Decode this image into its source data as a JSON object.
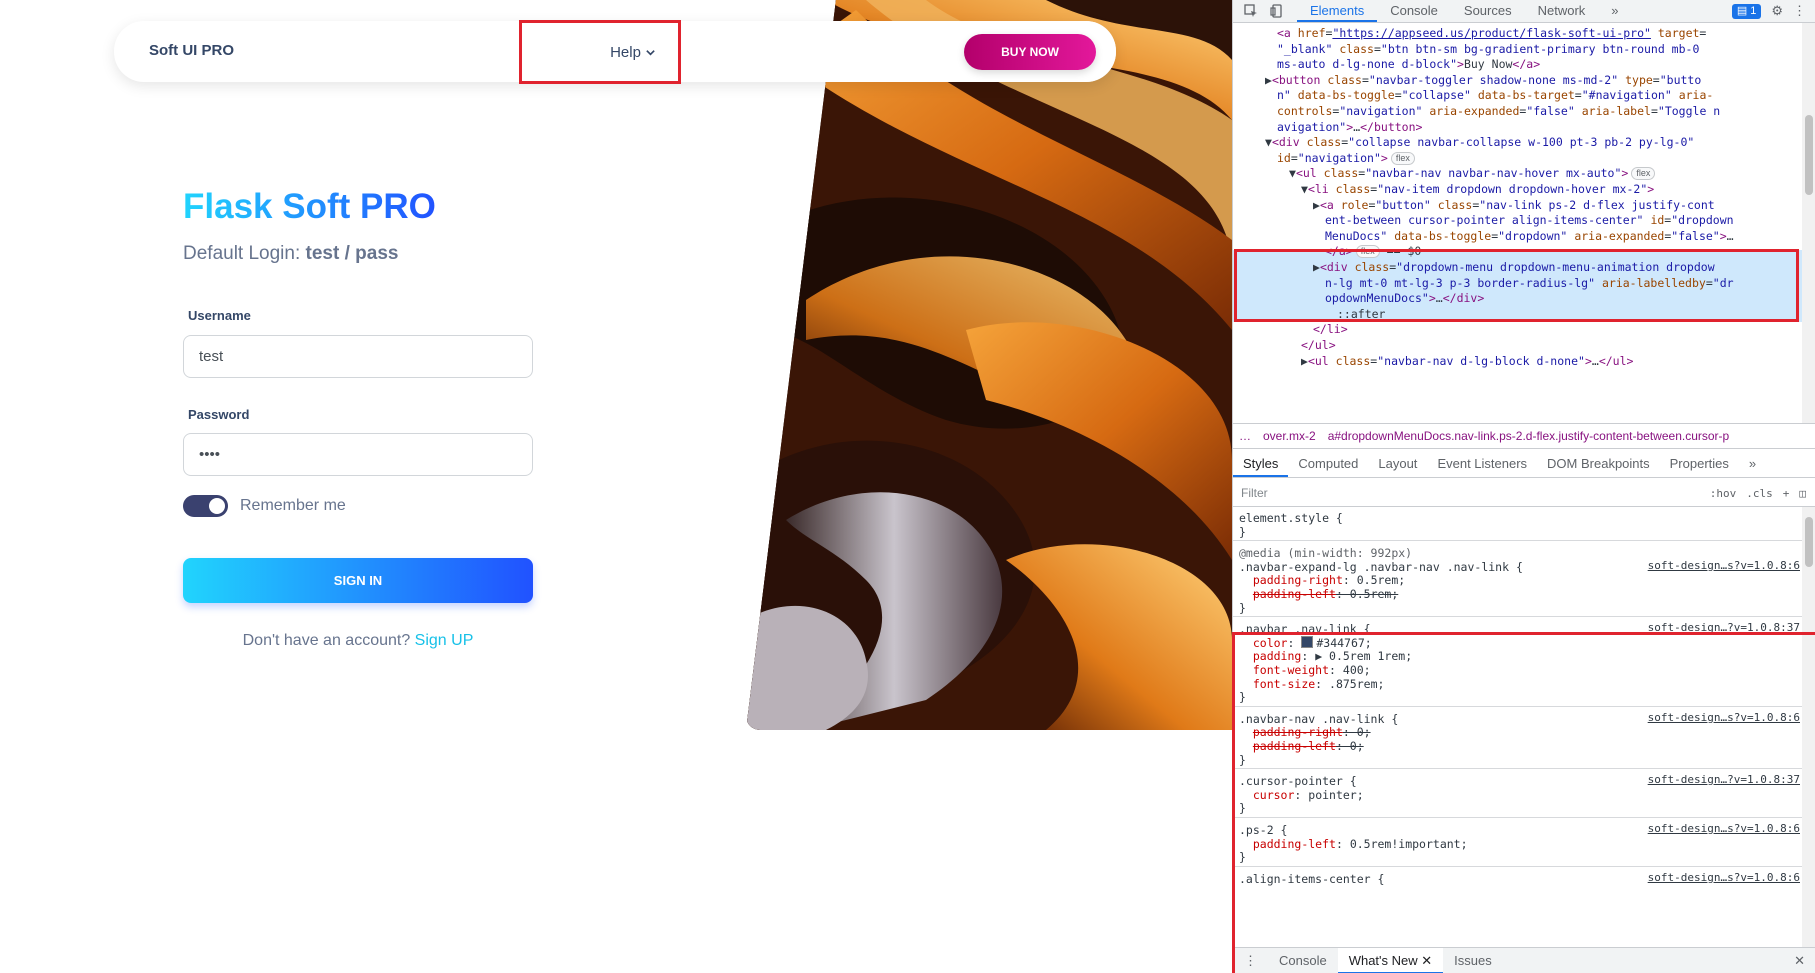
{
  "page": {
    "navbar": {
      "brand": "Soft UI PRO",
      "help_label": "Help",
      "buy_label": "BUY NOW"
    },
    "login": {
      "title": "Flask Soft PRO",
      "subtitle_prefix": "Default Login: ",
      "subtitle_credentials": "test / pass",
      "username_label": "Username",
      "username_value": "test",
      "password_label": "Password",
      "password_value": "••••",
      "remember_label": "Remember me",
      "remember_checked": true,
      "signin_label": "SIGN IN",
      "signup_prompt": "Don't have an account? ",
      "signup_link": "Sign UP"
    }
  },
  "devtools": {
    "tabs": [
      "Elements",
      "Console",
      "Sources",
      "Network"
    ],
    "more_tabs": "»",
    "issues_count": "1",
    "elements_lines": [
      {
        "indent": 3,
        "html": "<span class=\"tag\">&lt;a</span> <span class=\"attr\">href</span>=<span class=\"url\">\"https://appseed.us/product/flask-soft-ui-pro\"</span> <span class=\"attr\">target</span>="
      },
      {
        "indent": 3,
        "html": "<span class=\"val\">\"_blank\"</span> <span class=\"attr\">class</span>=<span class=\"val\">\"btn btn-sm  bg-gradient-primary  btn-round mb-0</span>"
      },
      {
        "indent": 3,
        "html": "<span class=\"val\">ms-auto d-lg-none d-block\"</span><span class=\"tag\">&gt;</span><span class=\"txt\">Buy Now</span><span class=\"tag\">&lt;/a&gt;</span>"
      },
      {
        "indent": 2,
        "html": "<span class=\"txt\">▶</span><span class=\"tag\">&lt;button</span> <span class=\"attr\">class</span>=<span class=\"val\">\"navbar-toggler shadow-none ms-md-2\"</span> <span class=\"attr\">type</span>=<span class=\"val\">\"butto</span>"
      },
      {
        "indent": 3,
        "html": "<span class=\"val\">n\"</span> <span class=\"attr\">data-bs-toggle</span>=<span class=\"val\">\"collapse\"</span> <span class=\"attr\">data-bs-target</span>=<span class=\"val\">\"#navigation\"</span> <span class=\"attr\">aria-</span>"
      },
      {
        "indent": 3,
        "html": "<span class=\"attr\">controls</span>=<span class=\"val\">\"navigation\"</span> <span class=\"attr\">aria-expanded</span>=<span class=\"val\">\"false\"</span> <span class=\"attr\">aria-label</span>=<span class=\"val\">\"Toggle n</span>"
      },
      {
        "indent": 3,
        "html": "<span class=\"val\">avigation\"</span><span class=\"tag\">&gt;</span><span class=\"txt\">…</span><span class=\"tag\">&lt;/button&gt;</span>"
      },
      {
        "indent": 2,
        "html": "<span class=\"txt\">▼</span><span class=\"tag\">&lt;div</span> <span class=\"attr\">class</span>=<span class=\"val\">\"collapse navbar-collapse w-100 pt-3 pb-2 py-lg-0\"</span>"
      },
      {
        "indent": 3,
        "html": "<span class=\"attr\">id</span>=<span class=\"val\">\"navigation\"</span><span class=\"tag\">&gt;</span><span class=\"pill\">flex</span>"
      },
      {
        "indent": 4,
        "html": "<span class=\"txt\">▼</span><span class=\"tag\">&lt;ul</span> <span class=\"attr\">class</span>=<span class=\"val\">\"navbar-nav navbar-nav-hover mx-auto\"</span><span class=\"tag\">&gt;</span><span class=\"pill\">flex</span>"
      },
      {
        "indent": 5,
        "html": "<span class=\"txt\">▼</span><span class=\"tag\">&lt;li</span> <span class=\"attr\">class</span>=<span class=\"val\">\"nav-item dropdown dropdown-hover mx-2\"</span><span class=\"tag\">&gt;</span>"
      },
      {
        "indent": 6,
        "html": "<span class=\"txt\">▶</span><span class=\"tag\">&lt;a</span> <span class=\"attr\">role</span>=<span class=\"val\">\"button\"</span> <span class=\"attr\">class</span>=<span class=\"val\">\"nav-link ps-2 d-flex justify-cont</span>"
      },
      {
        "indent": 7,
        "html": "<span class=\"val\">ent-between cursor-pointer align-items-center\"</span> <span class=\"attr\">id</span>=<span class=\"val\">\"dropdown</span>"
      },
      {
        "indent": 7,
        "html": "<span class=\"val\">MenuDocs\"</span> <span class=\"attr\">data-bs-toggle</span>=<span class=\"val\">\"dropdown\"</span> <span class=\"attr\">aria-expanded</span>=<span class=\"val\">\"false\"</span><span class=\"tag\">&gt;</span>…"
      },
      {
        "indent": 7,
        "html": "<span class=\"tag\">&lt;/a&gt;</span><span class=\"pill\">flex</span> <span class=\"txt\">== $0</span>"
      },
      {
        "indent": 6,
        "html": "<span class=\"txt\">▶</span><span class=\"tag\">&lt;div</span> <span class=\"attr\">class</span>=<span class=\"val\">\"dropdown-menu dropdown-menu-animation dropdow</span>"
      },
      {
        "indent": 7,
        "html": "<span class=\"val\">n-lg mt-0 mt-lg-3 p-3 border-radius-lg\"</span> <span class=\"attr\">aria-labelledby</span>=<span class=\"val\">\"dr</span>"
      },
      {
        "indent": 7,
        "html": "<span class=\"val\">opdownMenuDocs\"</span><span class=\"tag\">&gt;</span><span class=\"txt\">…</span><span class=\"tag\">&lt;/div&gt;</span>"
      },
      {
        "indent": 8,
        "html": "<span class=\"txt\">::after</span>"
      },
      {
        "indent": 6,
        "html": "<span class=\"tag\">&lt;/li&gt;</span>"
      },
      {
        "indent": 5,
        "html": "<span class=\"tag\">&lt;/ul&gt;</span>"
      },
      {
        "indent": 5,
        "html": "<span class=\"txt\">▶</span><span class=\"tag\">&lt;ul</span> <span class=\"attr\">class</span>=<span class=\"val\">\"navbar-nav d-lg-block d-none\"</span><span class=\"tag\">&gt;</span>…<span class=\"tag\">&lt;/ul&gt;</span>"
      }
    ],
    "breadcrumbs": [
      "…",
      "over.mx-2",
      "a#dropdownMenuDocs.nav-link.ps-2.d-flex.justify-content-between.cursor-p"
    ],
    "sub_tabs": [
      "Styles",
      "Computed",
      "Layout",
      "Event Listeners",
      "DOM Breakpoints",
      "Properties"
    ],
    "filter_placeholder": "Filter",
    "filter_hov": ":hov",
    "filter_cls": ".cls",
    "style_lines": [
      {
        "html": "<span class=\"sel\">element.style {</span>"
      },
      {
        "html": "<span class=\"sel\">}</span>"
      },
      {
        "html": "<span class=\"media\">@media (min-width: 992px)</span>"
      },
      {
        "html": "<span class=\"sel\">.navbar-expand-lg .navbar-nav .nav-link {</span>",
        "src": "soft-design…s?v=1.0.8:6"
      },
      {
        "html": "&nbsp;&nbsp;<span class=\"prop\">padding-right</span>: <span class=\"pval\">0.5rem;</span>"
      },
      {
        "html": "&nbsp;&nbsp;<span class=\"prop strike\">padding-left</span><span class=\"strike\">: 0.5rem;</span>"
      },
      {
        "html": "<span class=\"sel\">}</span>"
      },
      {
        "html": "<span class=\"sel\">.navbar .nav-link {</span>",
        "src": "soft-design…?v=1.0.8:37"
      },
      {
        "html": "&nbsp;&nbsp;<span class=\"prop\">color</span>: <span class=\"swatch\"></span><span class=\"pval\">#344767;</span>"
      },
      {
        "html": "&nbsp;&nbsp;<span class=\"prop\">padding</span>: <span class=\"pval\">▶ 0.5rem 1rem;</span>"
      },
      {
        "html": "&nbsp;&nbsp;<span class=\"prop\">font-weight</span>: <span class=\"pval\">400;</span>"
      },
      {
        "html": "&nbsp;&nbsp;<span class=\"prop\">font-size</span>: <span class=\"pval\">.875rem;</span>"
      },
      {
        "html": "<span class=\"sel\">}</span>"
      },
      {
        "html": "<span class=\"sel\">.navbar-nav .nav-link {</span>",
        "src": "soft-design…s?v=1.0.8:6"
      },
      {
        "html": "&nbsp;&nbsp;<span class=\"prop strike\">padding-right</span><span class=\"strike\">: 0;</span>"
      },
      {
        "html": "&nbsp;&nbsp;<span class=\"prop strike\">padding-left</span><span class=\"strike\">: 0;</span>"
      },
      {
        "html": "<span class=\"sel\">}</span>"
      },
      {
        "html": "<span class=\"sel\">.cursor-pointer {</span>",
        "src": "soft-design…?v=1.0.8:37"
      },
      {
        "html": "&nbsp;&nbsp;<span class=\"prop\">cursor</span>: <span class=\"pval\">pointer;</span>"
      },
      {
        "html": "<span class=\"sel\">}</span>"
      },
      {
        "html": "<span class=\"sel\">.ps-2 {</span>",
        "src": "soft-design…s?v=1.0.8:6"
      },
      {
        "html": "&nbsp;&nbsp;<span class=\"prop\">padding-left</span>: <span class=\"pval\">0.5rem!important;</span>"
      },
      {
        "html": "<span class=\"sel\">}</span>"
      },
      {
        "html": "<span class=\"sel\">.align-items-center {</span>",
        "src": "soft-design…s?v=1.0.8:6"
      }
    ],
    "drawer_tabs": [
      "Console",
      "What's New",
      "Issues"
    ]
  },
  "colors": {
    "nav_text": "#344767",
    "gradient_start": "#21d4fd",
    "gradient_end": "#2152ff",
    "buy_gradient_start": "#b3006b",
    "buy_gradient_end": "#e3189b",
    "highlight_red": "#e0232e",
    "devtools_accent": "#1a73e8"
  }
}
